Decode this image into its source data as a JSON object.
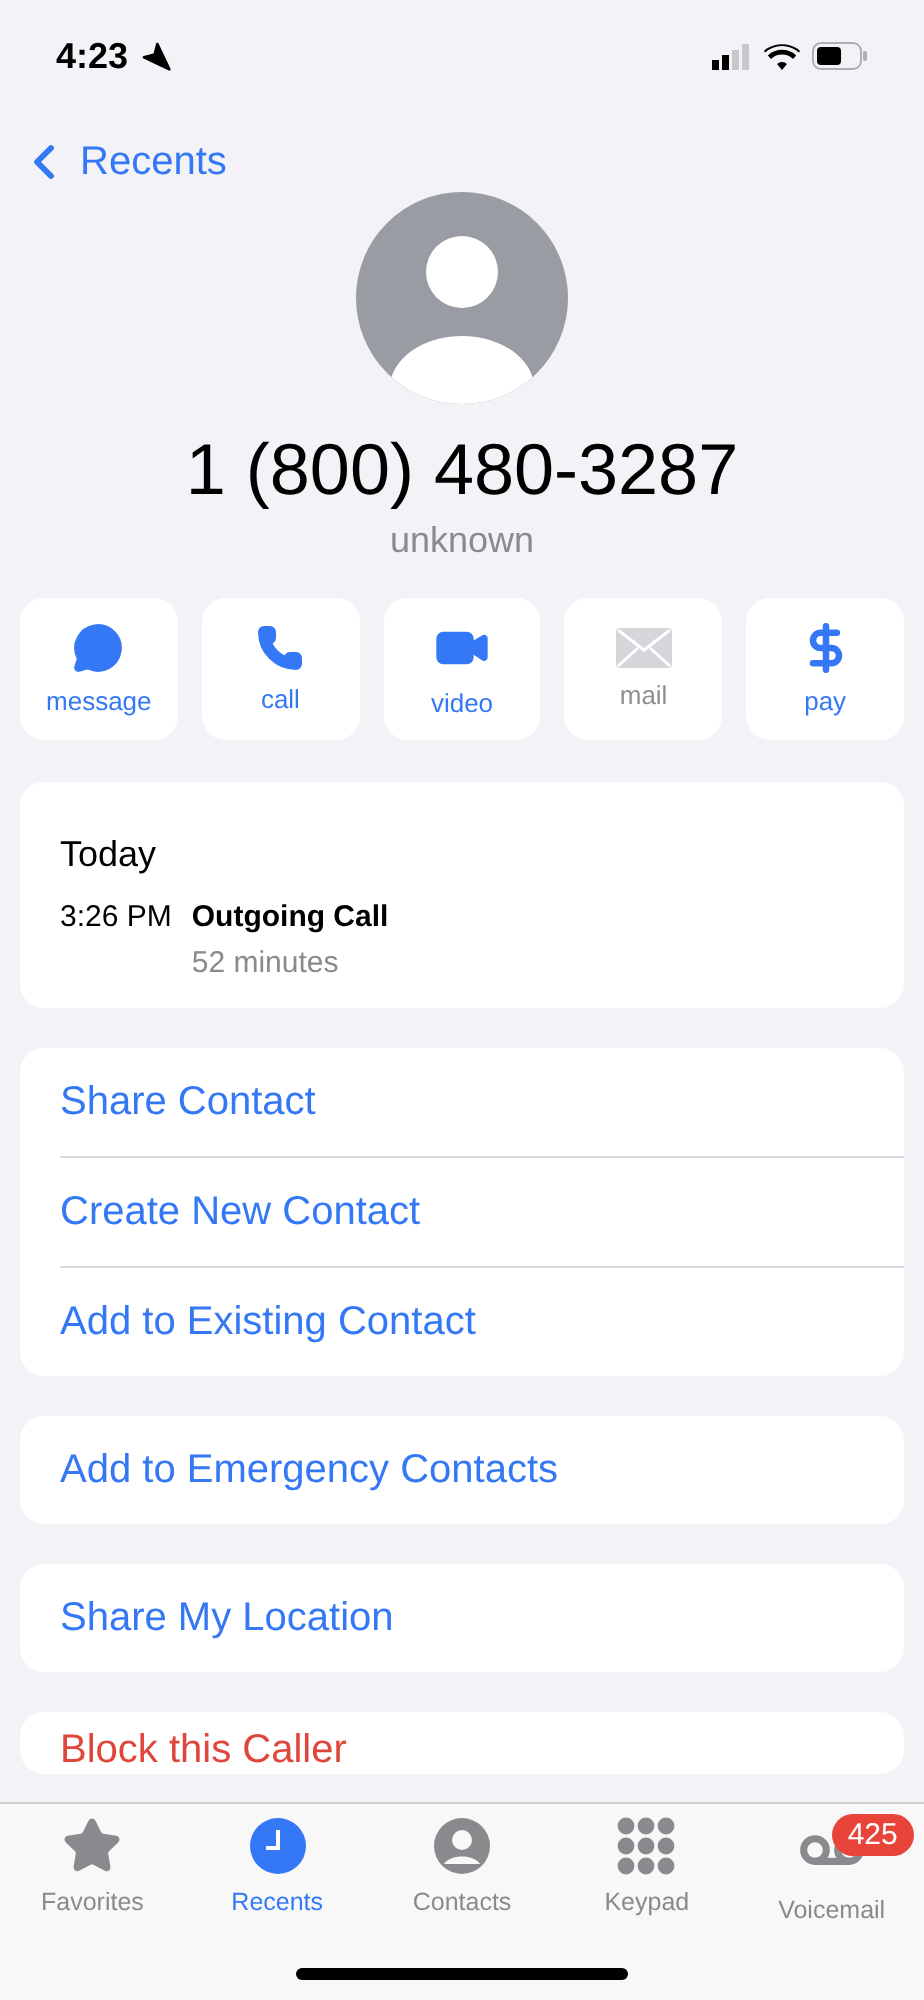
{
  "status_bar": {
    "time": "4:23"
  },
  "nav": {
    "back_label": "Recents"
  },
  "contact": {
    "number": "1 (800) 480-3287",
    "label": "unknown"
  },
  "actions": [
    {
      "kind": "message",
      "label": "message",
      "disabled": false
    },
    {
      "kind": "call",
      "label": "call",
      "disabled": false
    },
    {
      "kind": "video",
      "label": "video",
      "disabled": false
    },
    {
      "kind": "mail",
      "label": "mail",
      "disabled": true
    },
    {
      "kind": "pay",
      "label": "pay",
      "disabled": false
    }
  ],
  "history": {
    "heading": "Today",
    "entries": [
      {
        "time": "3:26 PM",
        "type": "Outgoing Call",
        "duration": "52 minutes"
      }
    ]
  },
  "groups": [
    [
      {
        "label": "Share Contact",
        "kind": "action"
      },
      {
        "label": "Create New Contact",
        "kind": "action"
      },
      {
        "label": "Add to Existing Contact",
        "kind": "action"
      }
    ],
    [
      {
        "label": "Add to Emergency Contacts",
        "kind": "action"
      }
    ],
    [
      {
        "label": "Share My Location",
        "kind": "action"
      }
    ],
    [
      {
        "label": "Block this Caller",
        "kind": "destructive"
      }
    ]
  ],
  "tabs": [
    {
      "kind": "favorites",
      "label": "Favorites",
      "selected": false
    },
    {
      "kind": "recents",
      "label": "Recents",
      "selected": true
    },
    {
      "kind": "contacts",
      "label": "Contacts",
      "selected": false
    },
    {
      "kind": "keypad",
      "label": "Keypad",
      "selected": false
    },
    {
      "kind": "voicemail",
      "label": "Voicemail",
      "selected": false,
      "badge": "425"
    }
  ]
}
